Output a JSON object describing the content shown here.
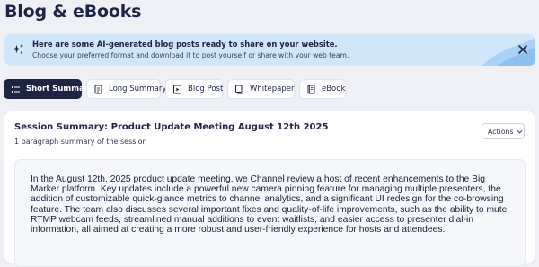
{
  "page": {
    "title": "Blog & eBooks"
  },
  "banner": {
    "title": "Here are some AI-generated blog posts ready to share on your website.",
    "subtitle": "Choose your preferred format and download it to post yourself or share with your web team.",
    "icons": {
      "leading": "sparkle-icon",
      "close": "close-icon"
    },
    "colors": {
      "background": "#cfe7fb",
      "accent": "#8fc1ef"
    }
  },
  "tabs": [
    {
      "label": "Short Summary",
      "icon": "list-icon",
      "active": true
    },
    {
      "label": "Long Summary",
      "icon": "document-icon",
      "active": false
    },
    {
      "label": "Blog Post",
      "icon": "play-document-icon",
      "active": false
    },
    {
      "label": "Whitepaper",
      "icon": "stacked-document-icon",
      "active": false
    },
    {
      "label": "eBook",
      "icon": "book-icon",
      "active": false
    }
  ],
  "summary_card": {
    "title": "Session Summary: Product Update Meeting August 12th 2025",
    "subtitle": "1 paragraph summary of the session",
    "actions_label": "Actions",
    "body": "In the August 12th, 2025 product update meeting, we Channel review a host of recent enhancements to the Big Marker platform. Key updates include a powerful new camera pinning feature for managing multiple presenters, the addition of customizable quick-glance metrics to channel analytics, and a significant UI redesign for the co-browsing feature. The team also discusses several important fixes and quality-of-life improvements, such as the ability to mute RTMP webcam feeds, streamlined manual additions to event waitlists, and easier access to presenter dial-in information, all aimed at creating a more robust and user-friendly experience for hosts and attendees."
  },
  "colors": {
    "primary": "#1d2444",
    "page_background": "#eef0f6"
  }
}
